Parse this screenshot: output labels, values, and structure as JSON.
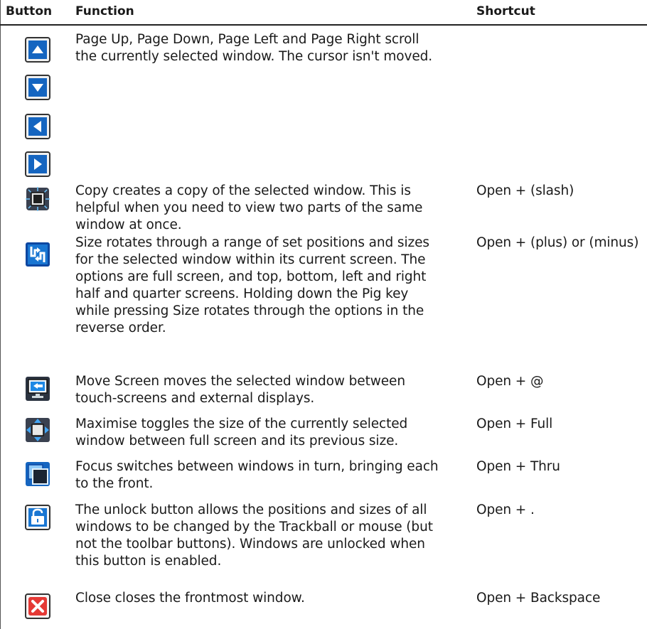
{
  "headers": {
    "button": "Button",
    "function": "Function",
    "shortcut": "Shortcut"
  },
  "rows": [
    {
      "icons": [
        "page-up-icon",
        "page-down-icon",
        "page-left-icon",
        "page-right-icon"
      ],
      "function_lines": [
        "Page Up, Page Down, Page Left and Page Right scroll",
        "the currently selected window. The cursor isn't moved."
      ],
      "shortcut": ""
    },
    {
      "icons": [
        "copy-window-icon"
      ],
      "function_lines": [
        "Copy creates a copy of the selected window. This is",
        "helpful when you need to view two parts of the same",
        "window at once."
      ],
      "shortcut": "Open + (slash)"
    },
    {
      "icons": [
        "size-rotate-icon"
      ],
      "function_lines": [
        "Size rotates through a range of set positions and sizes",
        "for the selected window within its current screen. The",
        "options are full screen, and top, bottom, left and right",
        "half and quarter screens. Holding down the Pig key",
        "while pressing Size rotates through the options in the",
        "reverse order."
      ],
      "shortcut": "Open + (plus) or (minus)"
    },
    {
      "icons": [
        "move-screen-icon"
      ],
      "function_lines": [
        "Move Screen moves the selected window between",
        "touch-screens and external displays."
      ],
      "shortcut": "Open + @"
    },
    {
      "icons": [
        "maximise-icon"
      ],
      "function_lines": [
        "Maximise toggles the size of the currently selected",
        "window between full screen and its previous size."
      ],
      "shortcut": "Open + Full"
    },
    {
      "icons": [
        "focus-icon"
      ],
      "function_lines": [
        "Focus switches between windows in turn, bringing each",
        "to the front."
      ],
      "shortcut": "Open + Thru"
    },
    {
      "icons": [
        "unlock-icon"
      ],
      "function_lines": [
        "The unlock button allows the positions and sizes of all",
        "windows to be changed by the Trackball or mouse (but",
        "not the toolbar buttons). Windows are unlocked when",
        "this button is enabled."
      ],
      "shortcut": "Open + ."
    },
    {
      "icons": [
        "close-window-icon"
      ],
      "function_lines": [
        "Close closes the frontmost window."
      ],
      "shortcut": "Open + Backspace"
    }
  ]
}
